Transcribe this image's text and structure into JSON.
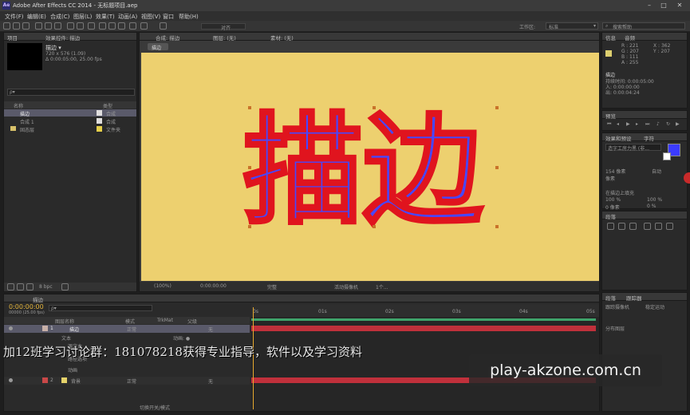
{
  "app": {
    "title": "Adobe After Effects CC 2014 - 无标题项目.aep",
    "icon_label": "Ae"
  },
  "menu": [
    "文件(F)",
    "编辑(E)",
    "合成(C)",
    "图层(L)",
    "效果(T)",
    "动画(A)",
    "视图(V)",
    "窗口",
    "帮助(H)"
  ],
  "toolbar": {
    "align_label": "对齐",
    "workspace_label": "工作区:",
    "workspace_value": "标准",
    "search_placeholder": "搜索帮助"
  },
  "project_panel": {
    "tab_project": "项目",
    "tab_effects": "效果控件: 描边",
    "comp_name": "描边 ▾",
    "comp_info1": "720 x 576 (1.09)",
    "comp_info2": "Δ 0:00:05:00, 25.00 fps",
    "search_placeholder": "ρ▾",
    "col_name": "名称",
    "col_type": "类型",
    "items": [
      {
        "name": "描边",
        "type": "合成",
        "color": "#e0dede"
      },
      {
        "name": "合成 1",
        "type": "合成",
        "color": "#e0dede"
      },
      {
        "name": "固态层",
        "type": "文件夹",
        "color": "#e6cf4a"
      }
    ],
    "bpc": "8 bpc"
  },
  "comp_panel": {
    "tab_comp": "合成: 描边",
    "tab_layer": "图层: (无)",
    "tab_footage": "素材: (无)",
    "breadcrumb": "描边",
    "text_content": "描边",
    "zoom": "(100%)",
    "timecode": "0:00:00:00",
    "quality": "完整",
    "camera": "活动摄像机",
    "views": "1个..."
  },
  "info_panel": {
    "tab_info": "信息",
    "tab_audio": "音频",
    "r": "R : 221",
    "g": "G : 207",
    "b": "B : 111",
    "a": "A : 255",
    "x": "X : 362",
    "y": "Y : 207",
    "layer_name": "描边",
    "duration": "持续时间: 0:00:05:00",
    "in_point": "入: 0:00:00:00",
    "out_point": "出: 0:00:04:24"
  },
  "preview_panel": {
    "tab": "预览"
  },
  "char_panel": {
    "tab_effects": "效果和预设",
    "tab_char": "字符",
    "font": "造字工房力黑 (非...",
    "size": "154 像素",
    "tracking": "自动",
    "leading": "像素",
    "vert_scale": "100 %",
    "horiz_scale": "100 %",
    "baseline": "0 像素",
    "tsume": "0 %",
    "stroke_label": "在描边上填充",
    "fill_color": "#3b3bff",
    "stroke_color": "#ffffff"
  },
  "paragraph_panel": {
    "tab_para": "段落",
    "tab_tracker": "跟踪器",
    "options1": "跟踪摄像机",
    "options2": "稳定运动",
    "sub": "分布图层"
  },
  "timeline": {
    "tab": "描边",
    "timecode": "0:00:00:00",
    "frame_info": "00000 (25.00 fps)",
    "search_placeholder": "ρ▾",
    "col_source": "图层名称",
    "col_mode": "模式",
    "col_trkmat": "TrkMat",
    "col_parent": "父级",
    "layers": [
      {
        "num": "1",
        "name": "描边",
        "mode": "正常",
        "parent": "无",
        "color": "#c8b0a8"
      },
      {
        "num": "2",
        "name": "背景",
        "mode": "正常",
        "parent": "无",
        "color": "#e6d36a"
      }
    ],
    "sub_labels": [
      "文本",
      "源文本",
      "路径选项",
      "动画"
    ],
    "anim_label": "动画: ●",
    "ruler": [
      "0s",
      "01s",
      "02s",
      "03s",
      "04s",
      "05s"
    ],
    "toggle_label": "切换开关/模式"
  },
  "overlay": {
    "promo_text": "加12班学习讨论群：181078218获得专业指导，软件以及学习资料",
    "site": "play-akzone.com.cn"
  }
}
